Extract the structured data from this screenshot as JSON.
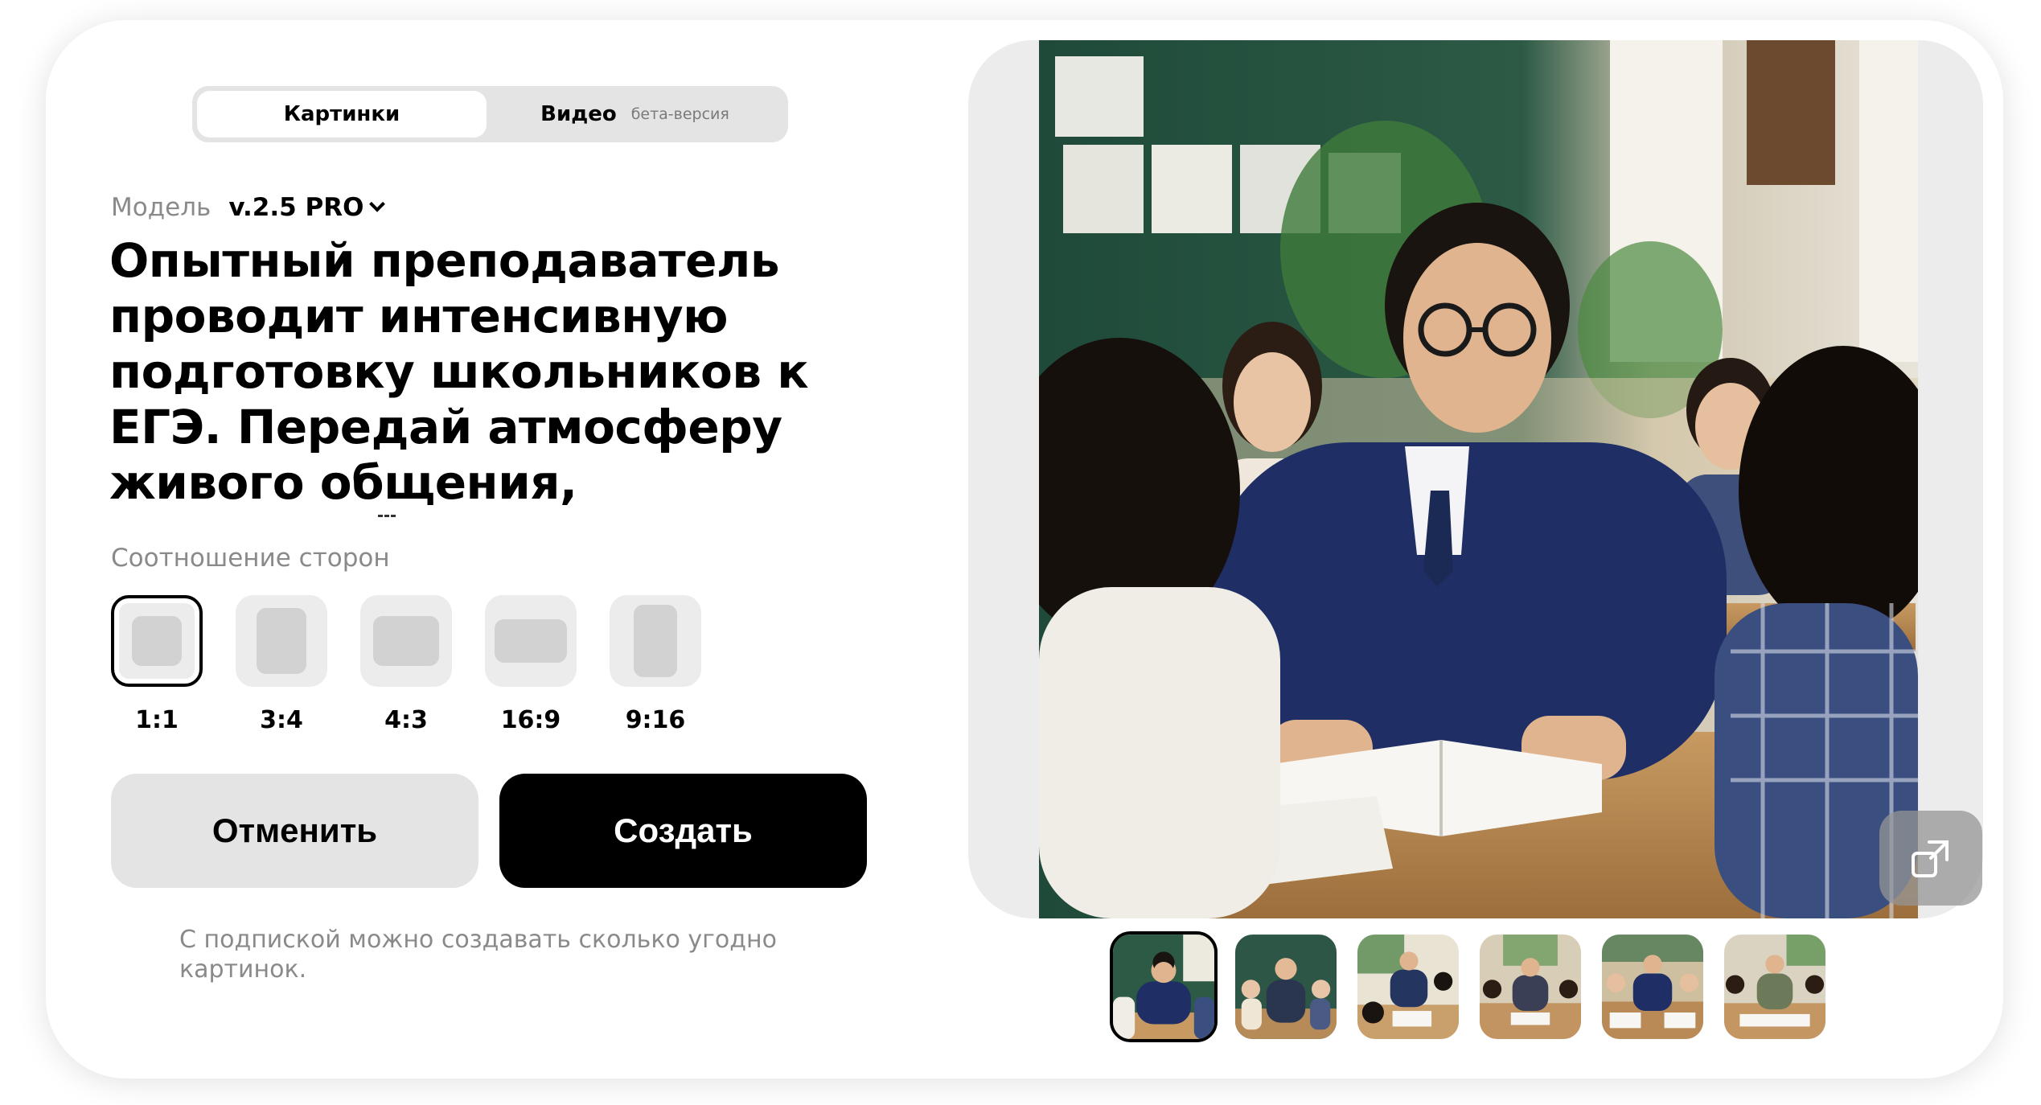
{
  "tabs": {
    "images_label": "Картинки",
    "video_label": "Видео",
    "video_badge": "бета-версия"
  },
  "model": {
    "label": "Модель",
    "value": "v.2.5 PRO"
  },
  "prompt": {
    "text": "Опытный преподаватель проводит интенсивную подготовку школьников к ЕГЭ. Передай атмосферу живого общения,"
  },
  "aspect": {
    "label": "Соотношение сторон",
    "options": [
      "1:1",
      "3:4",
      "4:3",
      "16:9",
      "9:16"
    ],
    "selected": "1:1"
  },
  "actions": {
    "cancel_label": "Отменить",
    "create_label": "Создать"
  },
  "note": {
    "text": "С подпиской можно создавать сколько угодно картинок."
  },
  "preview": {
    "image_icon": "classroom-photo",
    "expand_icon": "expand-icon",
    "thumbnail_count": 6,
    "selected_thumbnail": 1
  },
  "colors": {
    "accent": "#000000",
    "muted_text": "#8a8a8a",
    "panel_bg": "#e4e4e4"
  }
}
